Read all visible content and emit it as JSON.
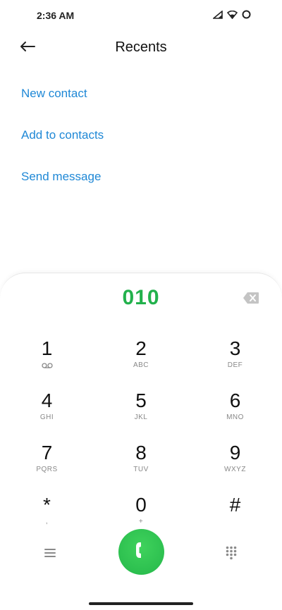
{
  "status_bar": {
    "time": "2:36 AM"
  },
  "header": {
    "title": "Recents"
  },
  "actions": [
    {
      "label": "New contact"
    },
    {
      "label": "Add to contacts"
    },
    {
      "label": "Send message"
    }
  ],
  "dialpad": {
    "number": "010",
    "keys": [
      {
        "digit": "1",
        "letters": ""
      },
      {
        "digit": "2",
        "letters": "ABC"
      },
      {
        "digit": "3",
        "letters": "DEF"
      },
      {
        "digit": "4",
        "letters": "GHI"
      },
      {
        "digit": "5",
        "letters": "JKL"
      },
      {
        "digit": "6",
        "letters": "MNO"
      },
      {
        "digit": "7",
        "letters": "PQRS"
      },
      {
        "digit": "8",
        "letters": "TUV"
      },
      {
        "digit": "9",
        "letters": "WXYZ"
      },
      {
        "digit": "*",
        "letters": ","
      },
      {
        "digit": "0",
        "letters": "+"
      },
      {
        "digit": "#",
        "letters": ""
      }
    ]
  },
  "colors": {
    "accent_blue": "#1f88d6",
    "number_green": "#22b14c",
    "call_green": "#34c759"
  },
  "icons": {
    "back": "arrow-left-icon",
    "backspace": "backspace-icon",
    "menu": "menu-icon",
    "call": "phone-icon",
    "keypad": "keypad-icon",
    "voicemail": "voicemail-icon"
  }
}
